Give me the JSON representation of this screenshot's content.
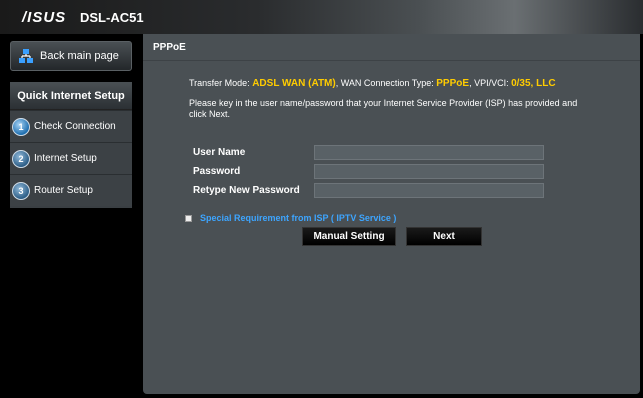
{
  "header": {
    "logo": "/ISUS",
    "model": "DSL-AC51"
  },
  "sidebar": {
    "back_label": "Back main page",
    "qis_title": "Quick Internet Setup",
    "steps": [
      {
        "num": "1",
        "label": "Check Connection"
      },
      {
        "num": "2",
        "label": "Internet Setup"
      },
      {
        "num": "3",
        "label": "Router Setup"
      }
    ]
  },
  "main": {
    "title": "PPPoE",
    "transfer_prefix": "Transfer Mode: ",
    "transfer_mode": "ADSL WAN (ATM)",
    "wan_prefix": ", WAN Connection Type: ",
    "wan_type": "PPPoE",
    "vpi_prefix": ", VPI/VCI: ",
    "vpi_value": "0/35, LLC",
    "instruction": "Please key in the user name/password that your Internet Service Provider (ISP) has provided and click Next.",
    "fields": {
      "username_label": "User Name",
      "password_label": "Password",
      "retype_label": "Retype New Password",
      "username_value": "",
      "password_value": "",
      "retype_value": ""
    },
    "special_label": "Special Requirement from ISP ( IPTV Service )",
    "manual_button": "Manual Setting",
    "next_button": "Next"
  },
  "colors": {
    "accent_yellow": "#ffcc00",
    "link_blue": "#3da5ff",
    "panel": "#4a5054"
  }
}
